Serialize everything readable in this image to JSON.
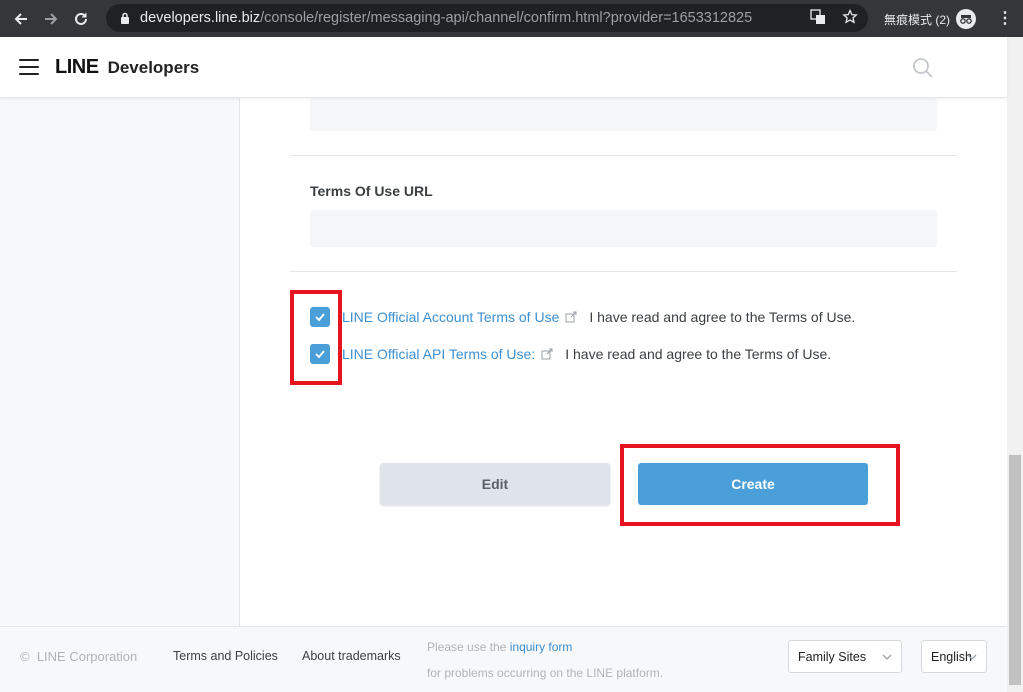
{
  "browser": {
    "url_host": "developers.line.biz",
    "url_path": "/console/register/messaging-api/channel/confirm.html?provider=1653312825",
    "profile_label": "無痕模式 (2)"
  },
  "header": {
    "brand_line": "LINE",
    "brand_developers": "Developers"
  },
  "form": {
    "terms_url_label": "Terms Of Use URL",
    "agreements": [
      {
        "link": "LINE Official Account Terms of Use",
        "text": "I have read and agree to the Terms of Use.",
        "checked": true
      },
      {
        "link": "LINE Official API Terms of Use:",
        "text": "I have read and agree to the Terms of Use.",
        "checked": true
      }
    ],
    "edit_label": "Edit",
    "create_label": "Create"
  },
  "footer": {
    "copyright_symbol": "©",
    "copyright": "LINE Corporation",
    "terms_link": "Terms and Policies",
    "trademarks_link": "About trademarks",
    "note_prefix": "Please use the",
    "note_link": "inquiry form",
    "note_line2": "for problems occurring on the LINE platform.",
    "family_sites": "Family Sites",
    "language": "English"
  },
  "colors": {
    "accent": "#4a9fd9",
    "link": "#3d8fd1",
    "highlight": "#e5141f"
  }
}
